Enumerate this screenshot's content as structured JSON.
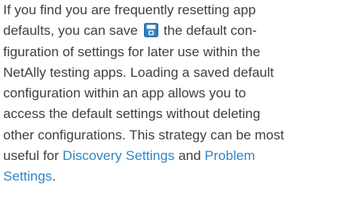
{
  "paragraph": {
    "line1": "If you find you are frequently resetting app",
    "line2_before_icon": "defaults, you can save",
    "line2_after_icon": "the default con-",
    "line3": "figuration of settings for later use within the",
    "line4": "NetAlly testing apps. Loading a saved default",
    "line5": "configuration within an app allows you to",
    "line6": "access the default settings without deleting",
    "line7": "other configurations. This strategy can be most",
    "line8_before_link": "useful for",
    "link_discovery_settings": "Discovery Settings",
    "line8_between_links": "and",
    "link_problem_settings_part1": "Problem",
    "link_problem_settings_part2": "Settings",
    "line9_after_link": "."
  },
  "icons": {
    "save_icon": "save-icon",
    "icon_color": "#2b7fc0"
  },
  "colors": {
    "text": "#3f3f3f",
    "link": "#2f86c8"
  }
}
